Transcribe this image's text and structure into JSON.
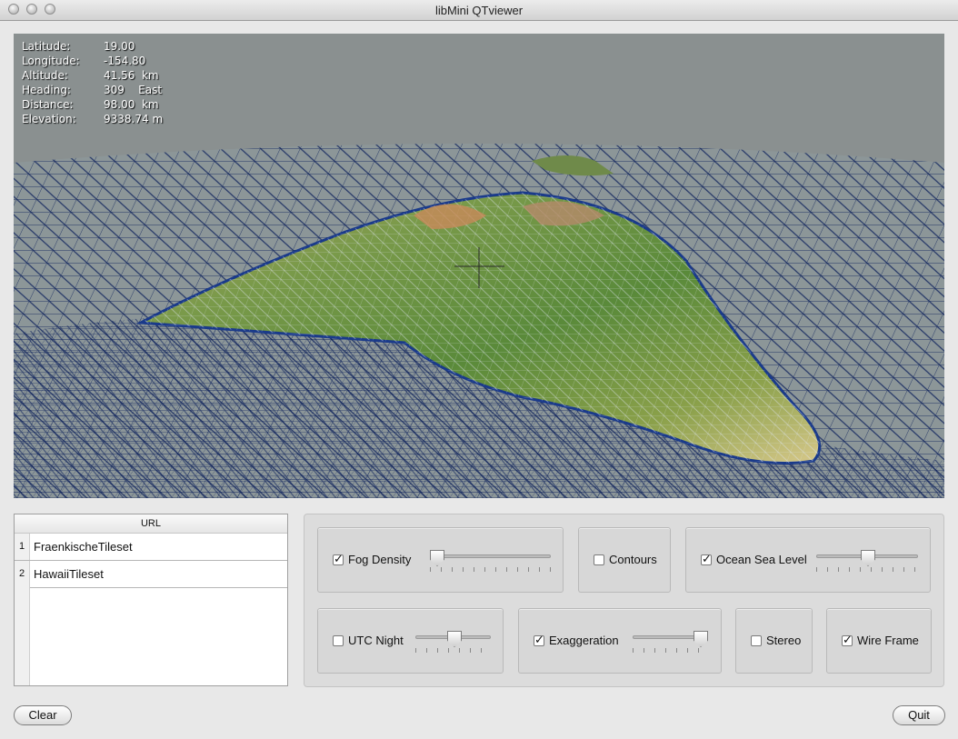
{
  "window": {
    "title": "libMini QTviewer"
  },
  "hud": {
    "rows": [
      {
        "label": "Latitude:",
        "value": "19.00"
      },
      {
        "label": "Longitude:",
        "value": "-154.80"
      },
      {
        "label": "Altitude:",
        "value": "41.56  km"
      },
      {
        "label": "Heading:",
        "value": "309    East"
      },
      {
        "label": "Distance:",
        "value": "98.00  km"
      },
      {
        "label": "Elevation:",
        "value": "9338.74 m"
      }
    ]
  },
  "url_table": {
    "header": "URL",
    "rows": [
      {
        "num": "1",
        "url": "FraenkischeTileset"
      },
      {
        "num": "2",
        "url": "HawaiiTileset"
      }
    ]
  },
  "controls": {
    "fog_density": {
      "label": "Fog Density",
      "checked": true,
      "slider_value": 0.0
    },
    "contours": {
      "label": "Contours",
      "checked": false
    },
    "ocean_sea_level": {
      "label": "Ocean Sea Level",
      "checked": true,
      "slider_value": 0.5
    },
    "utc_night": {
      "label": "UTC Night",
      "checked": false,
      "slider_value": 0.5
    },
    "exaggeration": {
      "label": "Exaggeration",
      "checked": true,
      "slider_value": 1.0
    },
    "stereo": {
      "label": "Stereo",
      "checked": false
    },
    "wire_frame": {
      "label": "Wire Frame",
      "checked": true
    }
  },
  "buttons": {
    "clear": "Clear",
    "quit": "Quit"
  },
  "colors": {
    "sky": "#8a9090",
    "wire": "#0a1e5a",
    "window_bg": "#e8e8e8"
  }
}
